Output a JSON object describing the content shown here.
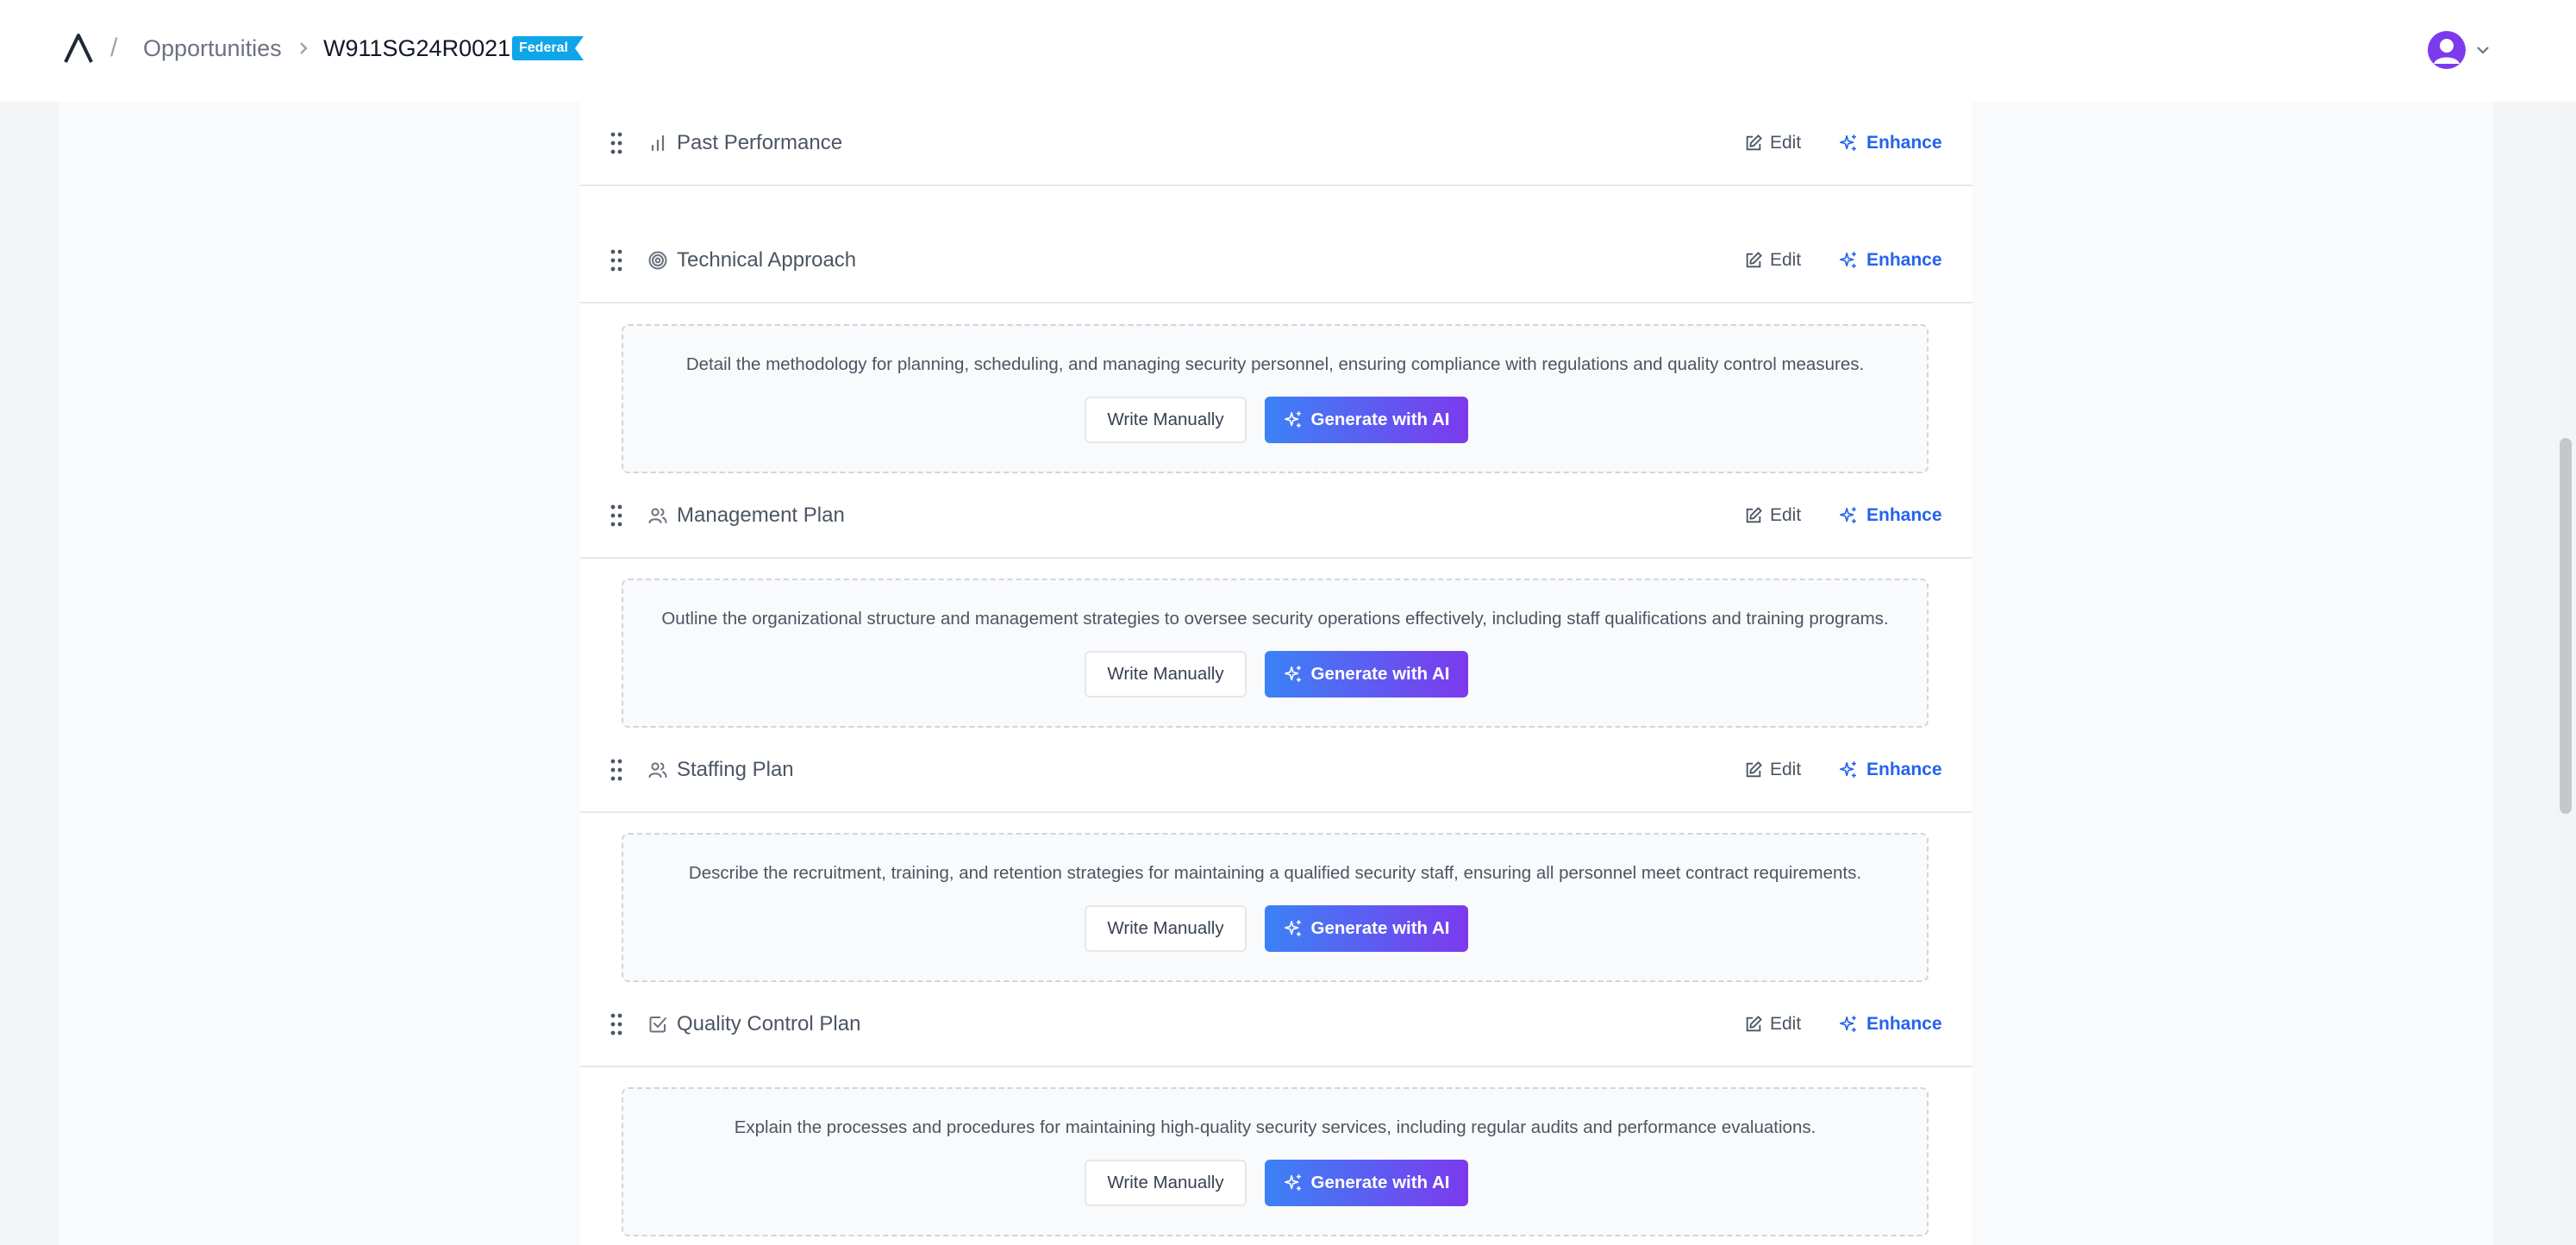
{
  "header": {
    "breadcrumb_separator": "/",
    "opportunities_label": "Opportunities",
    "opportunity_id": "W911SG24R0021",
    "badge": "Federal"
  },
  "actions": {
    "edit_label": "Edit",
    "enhance_label": "Enhance",
    "write_label": "Write Manually",
    "generate_label": "Generate with AI"
  },
  "sections": [
    {
      "title": "Past Performance",
      "icon": "bar-chart-icon"
    },
    {
      "title": "Technical Approach",
      "icon": "target-icon",
      "description": "Detail the methodology for planning, scheduling, and managing security personnel, ensuring compliance with regulations and quality control measures."
    },
    {
      "title": "Management Plan",
      "icon": "users-icon",
      "description": "Outline the organizational structure and management strategies to oversee security operations effectively, including staff qualifications and training programs."
    },
    {
      "title": "Staffing Plan",
      "icon": "users-icon",
      "description": "Describe the recruitment, training, and retention strategies for maintaining a qualified security staff, ensuring all personnel meet contract requirements."
    },
    {
      "title": "Quality Control Plan",
      "icon": "checkbox-icon",
      "description": "Explain the processes and procedures for maintaining high-quality security services, including regular audits and performance evaluations."
    }
  ],
  "colors": {
    "accent": "#2563eb",
    "badge": "#0ea5e9",
    "ai_gradient_start": "#3b82f6",
    "ai_gradient_end": "#7c3aed"
  }
}
